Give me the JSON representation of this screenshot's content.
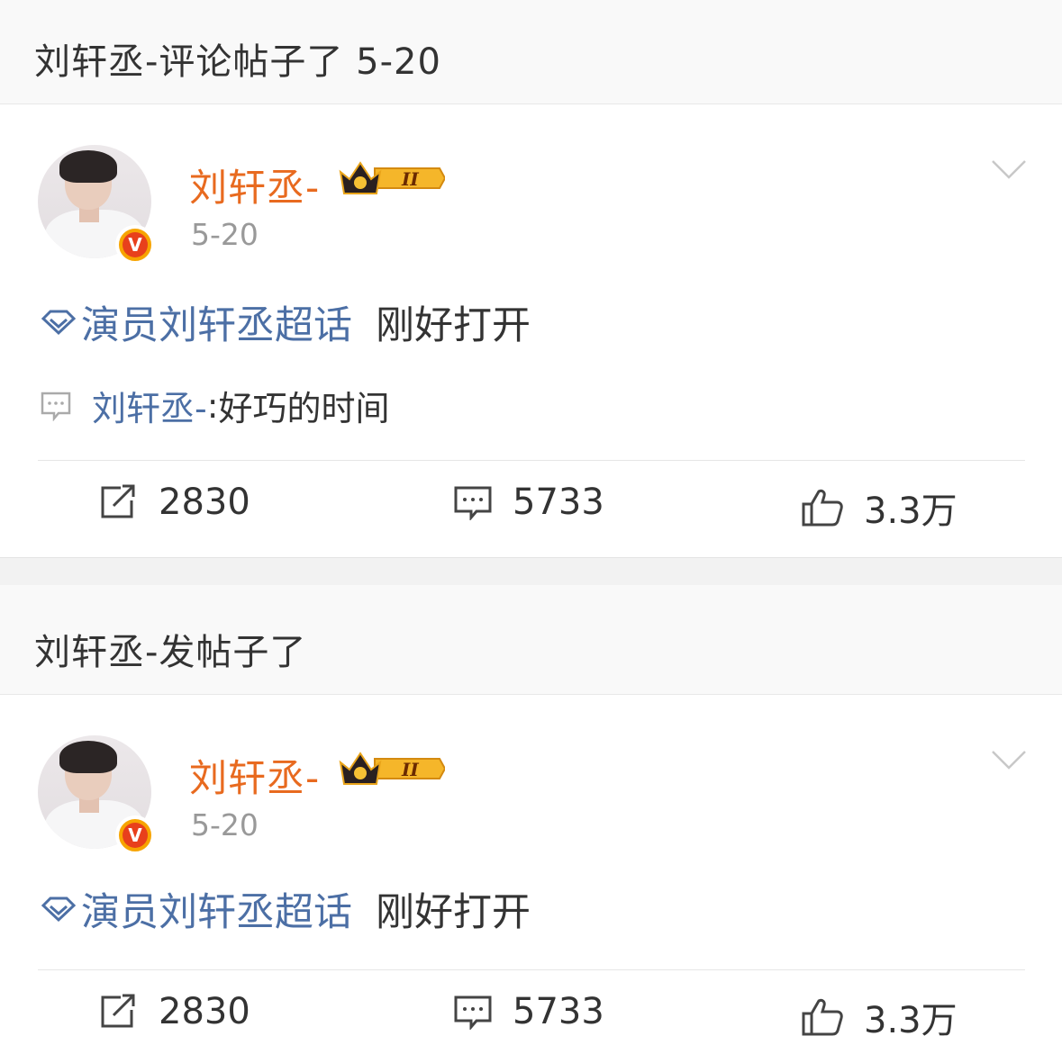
{
  "sections": [
    {
      "header": "刘轩丞-评论帖子了 5-20",
      "post": {
        "username": "刘轩丞-",
        "vip_level": "II",
        "date": "5-20",
        "topic": "演员刘轩丞超话",
        "text": "刚好打开",
        "comment": {
          "author": "刘轩丞-",
          "separator": ": ",
          "text": "好巧的时间"
        },
        "stats": {
          "reposts": "2830",
          "comments": "5733",
          "likes": "3.3万"
        }
      }
    },
    {
      "header": "刘轩丞-发帖子了",
      "post": {
        "username": "刘轩丞-",
        "vip_level": "II",
        "date": "5-20",
        "topic": "演员刘轩丞超话",
        "text": "刚好打开",
        "stats": {
          "reposts": "2830",
          "comments": "5733",
          "likes": "3.3万"
        }
      }
    }
  ],
  "colors": {
    "username": "#e86a1f",
    "topic_link": "#4c6fa5",
    "date": "#999999",
    "verified_badge": "#f7a400"
  },
  "icons": {
    "repost": "repost-icon",
    "comment": "comment-icon",
    "like": "thumbs-up-icon",
    "more": "chevron-down-icon",
    "topic": "diamond-topic-icon",
    "verified": "verified-v-icon",
    "vip": "crown-vip-icon"
  }
}
